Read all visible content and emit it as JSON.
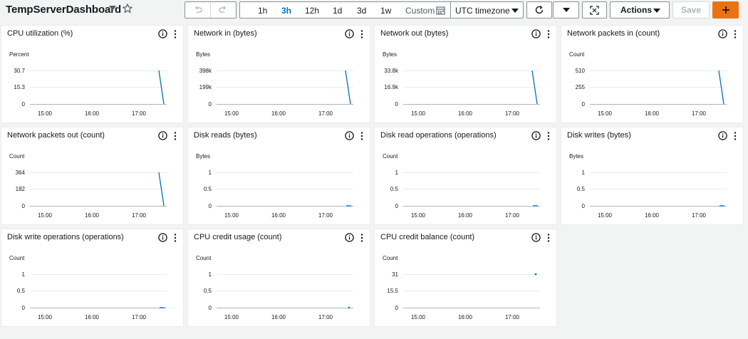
{
  "dashboard": {
    "title": "TempServerDashboard"
  },
  "toolbar": {
    "ranges": [
      "1h",
      "3h",
      "12h",
      "1d",
      "3d",
      "1w"
    ],
    "active_range": "3h",
    "custom_label": "Custom",
    "timezone_label": "UTC timezone",
    "actions_label": "Actions",
    "save_label": "Save",
    "add_label": "+"
  },
  "icons": {
    "title_dropdown": "caret-down-icon",
    "favorite": "star-icon",
    "undo": "undo-icon",
    "redo": "redo-icon",
    "calendar": "calendar-icon",
    "refresh": "refresh-icon",
    "fullscreen": "fullscreen-icon",
    "info": "info-icon",
    "menu": "kebab-menu-icon"
  },
  "colors": {
    "accent": "#0073bb",
    "primary_button": "#ec7211",
    "series": "#0073bb",
    "grid": "#e9ebed"
  },
  "widgets": [
    {
      "title": "CPU utilization (%)",
      "unit": "Percent",
      "yticks": [
        "30.7",
        "15.3",
        "0"
      ],
      "xticks": [
        "15:00",
        "16:00",
        "17:00"
      ],
      "shape": "spike"
    },
    {
      "title": "Network in (bytes)",
      "unit": "Bytes",
      "yticks": [
        "398k",
        "199k",
        "0"
      ],
      "xticks": [
        "15:00",
        "16:00",
        "17:00"
      ],
      "shape": "spike"
    },
    {
      "title": "Network out (bytes)",
      "unit": "Bytes",
      "yticks": [
        "33.8k",
        "16.9k",
        "0"
      ],
      "xticks": [
        "15:00",
        "16:00",
        "17:00"
      ],
      "shape": "spike"
    },
    {
      "title": "Network packets in (count)",
      "unit": "Count",
      "yticks": [
        "510",
        "255",
        "0"
      ],
      "xticks": [
        "15:00",
        "16:00",
        "17:00"
      ],
      "shape": "spike"
    },
    {
      "title": "Network packets out (count)",
      "unit": "Count",
      "yticks": [
        "364",
        "182",
        "0"
      ],
      "xticks": [
        "15:00",
        "16:00",
        "17:00"
      ],
      "shape": "spike"
    },
    {
      "title": "Disk reads (bytes)",
      "unit": "Bytes",
      "yticks": [
        "1",
        "0.5",
        "0"
      ],
      "xticks": [
        "15:00",
        "16:00",
        "17:00"
      ],
      "shape": "flat"
    },
    {
      "title": "Disk read operations (operations)",
      "unit": "Count",
      "yticks": [
        "1",
        "0.5",
        "0"
      ],
      "xticks": [
        "15:00",
        "16:00",
        "17:00"
      ],
      "shape": "flat"
    },
    {
      "title": "Disk writes (bytes)",
      "unit": "Bytes",
      "yticks": [
        "1",
        "0.5",
        "0"
      ],
      "xticks": [
        "15:00",
        "16:00",
        "17:00"
      ],
      "shape": "flat"
    },
    {
      "title": "Disk write operations (operations)",
      "unit": "Count",
      "yticks": [
        "1",
        "0.5",
        "0"
      ],
      "xticks": [
        "15:00",
        "16:00",
        "17:00"
      ],
      "shape": "flat"
    },
    {
      "title": "CPU credit usage (count)",
      "unit": "Count",
      "yticks": [
        "1",
        "0.5",
        "0"
      ],
      "xticks": [
        "15:00",
        "16:00",
        "17:00"
      ],
      "shape": "dot-low"
    },
    {
      "title": "CPU credit balance (count)",
      "unit": "Count",
      "yticks": [
        "31",
        "15.5",
        "0"
      ],
      "xticks": [
        "15:00",
        "16:00",
        "17:00"
      ],
      "shape": "dot-high"
    }
  ]
}
